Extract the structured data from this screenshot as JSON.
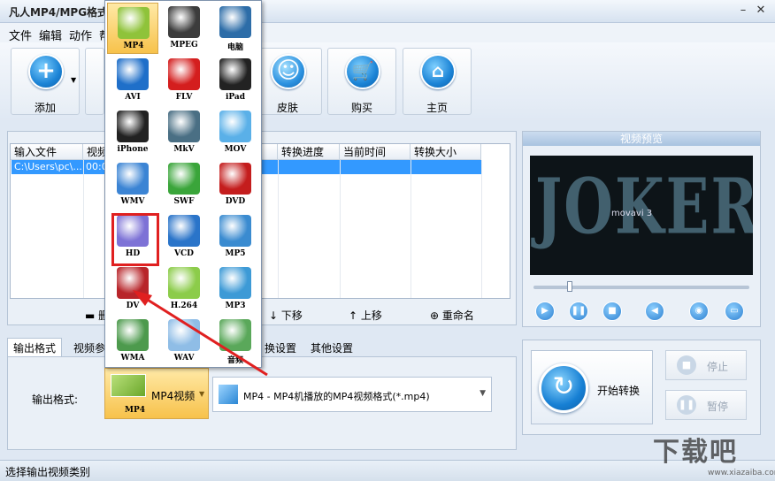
{
  "window": {
    "title": "凡人MP4/MPG格式转",
    "minimize": "–",
    "close": "✕"
  },
  "menu": [
    "文件",
    "编辑",
    "动作",
    "帮"
  ],
  "toolbar": {
    "add": "添加",
    "skin": "皮肤",
    "buy": "购买",
    "home": "主页"
  },
  "file_list": {
    "columns": [
      "输入文件",
      "视频",
      "转换进度",
      "当前时间",
      "转换大小"
    ],
    "rows": [
      {
        "input": "C:\\Users\\pc\\...",
        "video": "00:0"
      }
    ]
  },
  "list_actions": {
    "down": "下移",
    "up": "上移",
    "rename": "重命名",
    "delete": "删"
  },
  "preview": {
    "title": "视频预览",
    "poster_text": "JOKER",
    "poster_small": "movavi 3"
  },
  "tabs": [
    "输出格式",
    "视频参",
    "换设置",
    "其他设置"
  ],
  "output": {
    "label": "输出格式:",
    "button_label": "MP4视频",
    "button_sub": "MP4",
    "select_value": "MP4 - MP4机播放的MP4视频格式(*.mp4)"
  },
  "convert": {
    "start": "开始转换",
    "stop": "停止",
    "pause": "暂停"
  },
  "status": {
    "text": "选择输出视频类别"
  },
  "watermark": {
    "text": "下载吧",
    "url": "www.xiazaiba.com"
  },
  "format_menu": {
    "items": [
      {
        "label": "MP4",
        "icon": "mp4-icon",
        "color": "#8fc33a"
      },
      {
        "label": "MPEG",
        "icon": "film-reel-icon",
        "color": "#3c3c3c"
      },
      {
        "label": "电脑",
        "icon": "monitor-icon",
        "color": "#2d6da8"
      },
      {
        "label": "AVI",
        "icon": "avi-play-icon",
        "color": "#1f6fc9"
      },
      {
        "label": "FLV",
        "icon": "flash-icon",
        "color": "#d41e1e"
      },
      {
        "label": "iPad",
        "icon": "ipad-icon",
        "color": "#222222"
      },
      {
        "label": "iPhone",
        "icon": "iphone-icon",
        "color": "#222222"
      },
      {
        "label": "MkV",
        "icon": "film-roll-icon",
        "color": "#4a6f84"
      },
      {
        "label": "MOV",
        "icon": "quicktime-icon",
        "color": "#5ab0e8"
      },
      {
        "label": "WMV",
        "icon": "wmv-play-icon",
        "color": "#3b84d4"
      },
      {
        "label": "SWF",
        "icon": "swf-icon",
        "color": "#3aa53a"
      },
      {
        "label": "DVD",
        "icon": "dvd-icon",
        "color": "#c41d1d"
      },
      {
        "label": "HD",
        "icon": "hd-reel-icon",
        "color": "#7d72d6"
      },
      {
        "label": "VCD",
        "icon": "vcd-disc-icon",
        "color": "#2a74c9"
      },
      {
        "label": "MP5",
        "icon": "mp5-screen-icon",
        "color": "#3a8bd0"
      },
      {
        "label": "DV",
        "icon": "camcorder-icon",
        "color": "#b8252a"
      },
      {
        "label": "H.264",
        "icon": "cube-icon",
        "color": "#8ccc4a"
      },
      {
        "label": "MP3",
        "icon": "speaker-icon",
        "color": "#3d9ad6"
      },
      {
        "label": "WMA",
        "icon": "music-note-icon",
        "color": "#4d9a4d"
      },
      {
        "label": "WAV",
        "icon": "wav-icon",
        "color": "#8fbde6"
      },
      {
        "label": "音频",
        "icon": "audio-disc-icon",
        "color": "#5aa85a"
      }
    ],
    "selected": "MP4",
    "highlighted": "HD"
  }
}
